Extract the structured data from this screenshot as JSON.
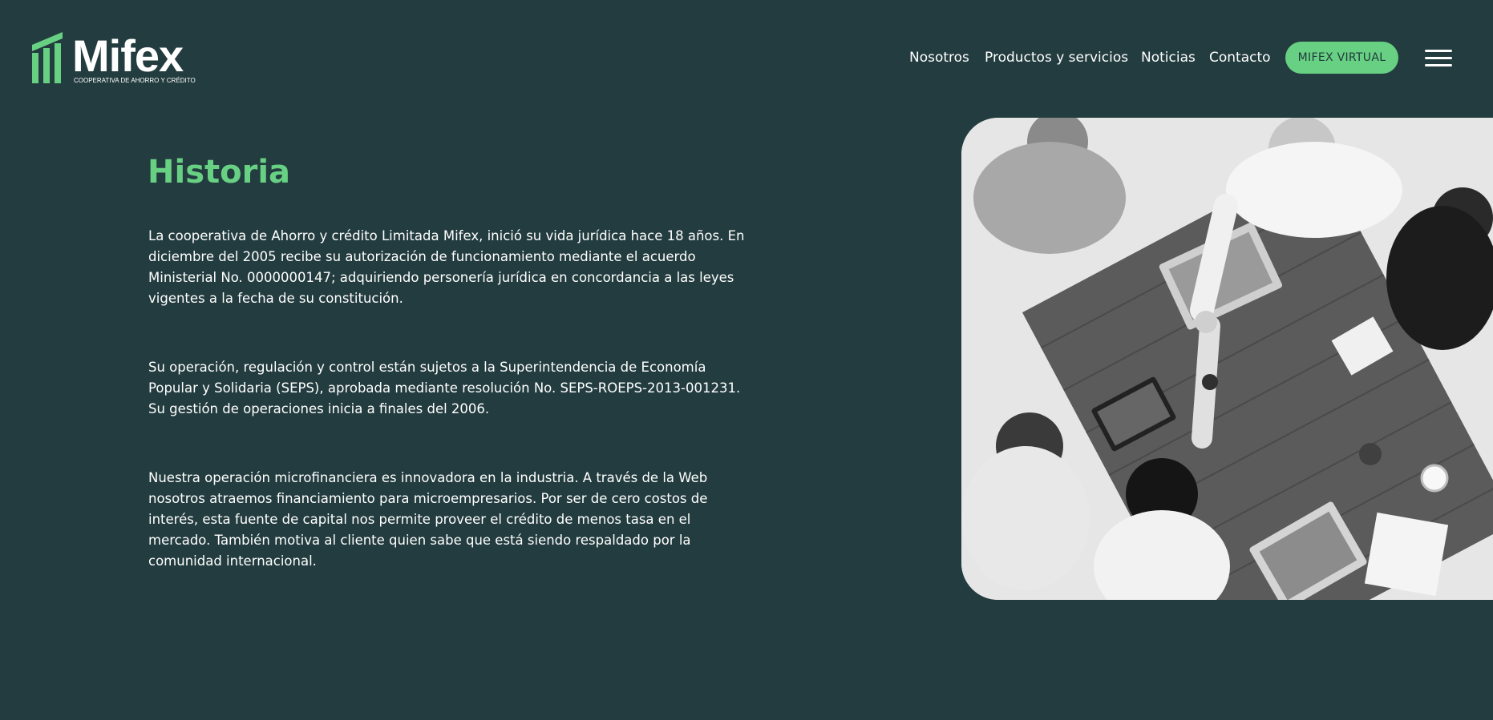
{
  "brand": {
    "name": "Mifex",
    "tagline": "COOPERATIVA DE AHORRO Y CRÉDITO",
    "logo_color": "#68d083"
  },
  "nav": {
    "links": [
      {
        "label": "Nosotros"
      },
      {
        "label": "Productos y servicios"
      },
      {
        "label": "Noticias"
      },
      {
        "label": "Contacto"
      }
    ],
    "cta_label": "MIFEX VIRTUAL",
    "menu_icon": "hamburger-menu-icon"
  },
  "main": {
    "title": "Historia",
    "paragraphs": [
      "La cooperativa de Ahorro y crédito Limitada Mifex, inició su vida jurídica hace 18 años. En diciembre del 2005 recibe su autorización de funcionamiento mediante el acuerdo Ministerial No. 0000000147; adquiriendo personería jurídica en concordancia a las leyes vigentes a la fecha de su constitución.",
      "Su operación, regulación y control están sujetos a la Superintendencia de Economía Popular y Solidaria (SEPS), aprobada mediante resolución No. SEPS-ROEPS-2013-001231. Su gestión de operaciones inicia a finales del 2006.",
      "Nuestra operación microfinanciera es innovadora en la industria. A través de la Web nosotros atraemos financiamiento para microempresarios. Por ser de cero costos de interés, esta fuente de capital nos permite proveer el crédito de menos tasa en el mercado. También motiva al cliente quien sabe que está siendo respaldado por la comunidad internacional."
    ],
    "image_icon": "team-meeting-photo"
  },
  "colors": {
    "background": "#233c3f",
    "accent": "#68d083",
    "text": "#ffffff"
  }
}
